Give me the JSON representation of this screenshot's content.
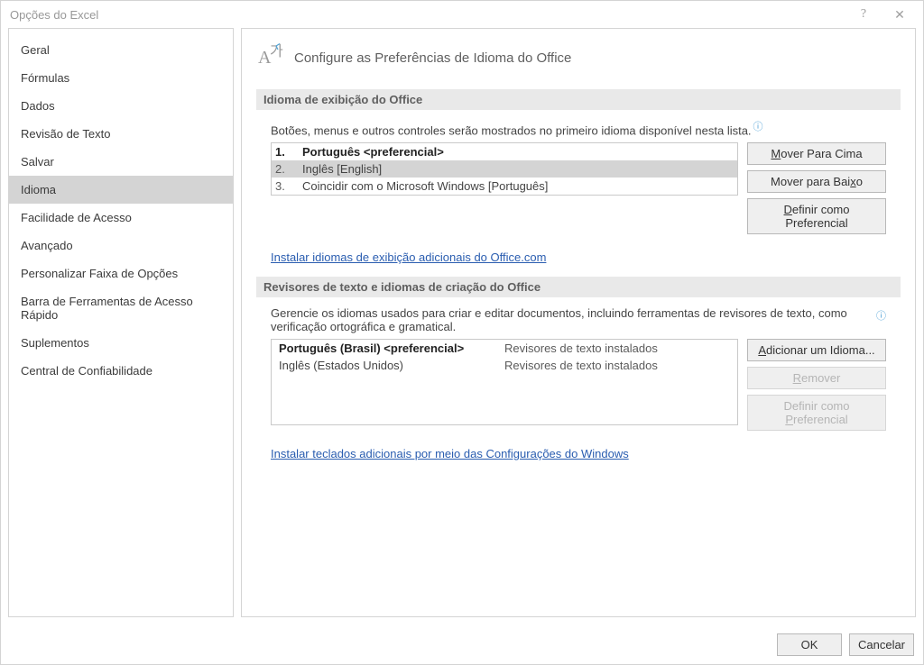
{
  "window": {
    "title": "Opções do Excel"
  },
  "sidebar": {
    "items": [
      {
        "label": "Geral"
      },
      {
        "label": "Fórmulas"
      },
      {
        "label": "Dados"
      },
      {
        "label": "Revisão de Texto"
      },
      {
        "label": "Salvar"
      },
      {
        "label": "Idioma",
        "selected": true
      },
      {
        "label": "Facilidade de Acesso"
      },
      {
        "label": "Avançado"
      },
      {
        "label": "Personalizar Faixa de Opções"
      },
      {
        "label": "Barra de Ferramentas de Acesso Rápido"
      },
      {
        "label": "Suplementos"
      },
      {
        "label": "Central de Confiabilidade"
      }
    ]
  },
  "heading": {
    "icon": "language-icon",
    "text": "Configure as Preferências de Idioma do Office"
  },
  "section_display": {
    "title": "Idioma de exibição do Office",
    "desc": "Botões, menus e outros controles serão mostrados no primeiro idioma disponível nesta lista.",
    "items": [
      {
        "num": "1.",
        "label": "Português <preferencial>",
        "preferred": true
      },
      {
        "num": "2.",
        "label": "Inglês [English]",
        "selected": true
      },
      {
        "num": "3.",
        "label": "Coincidir com o Microsoft Windows [Português]"
      }
    ],
    "buttons": {
      "move_up": {
        "pre": "",
        "key": "M",
        "post": "over Para Cima"
      },
      "move_down": {
        "pre": "Mover para Bai",
        "key": "x",
        "post": "o"
      },
      "set_pref": {
        "pre": "",
        "key": "D",
        "post": "efinir como Preferencial"
      }
    },
    "link": "Instalar idiomas de exibição adicionais do Office.com"
  },
  "section_proof": {
    "title": "Revisores de texto e idiomas de criação do Office",
    "desc": "Gerencie os idiomas usados para criar e editar documentos, incluindo ferramentas de revisores de texto, como verificação ortográfica e gramatical.",
    "items": [
      {
        "lang": "Português (Brasil) <preferencial>",
        "status": "Revisores de texto instalados",
        "preferred": true
      },
      {
        "lang": "Inglês (Estados Unidos)",
        "status": "Revisores de texto instalados"
      }
    ],
    "buttons": {
      "add": {
        "pre": "",
        "key": "A",
        "post": "dicionar um Idioma..."
      },
      "remove": {
        "pre": "",
        "key": "R",
        "post": "emover",
        "disabled": true
      },
      "set_pref": {
        "pre": "Definir como ",
        "key": "P",
        "post": "referencial",
        "disabled": true
      }
    },
    "link": "Instalar teclados adicionais por meio das Configurações do Windows"
  },
  "footer": {
    "ok": "OK",
    "cancel": "Cancelar"
  }
}
